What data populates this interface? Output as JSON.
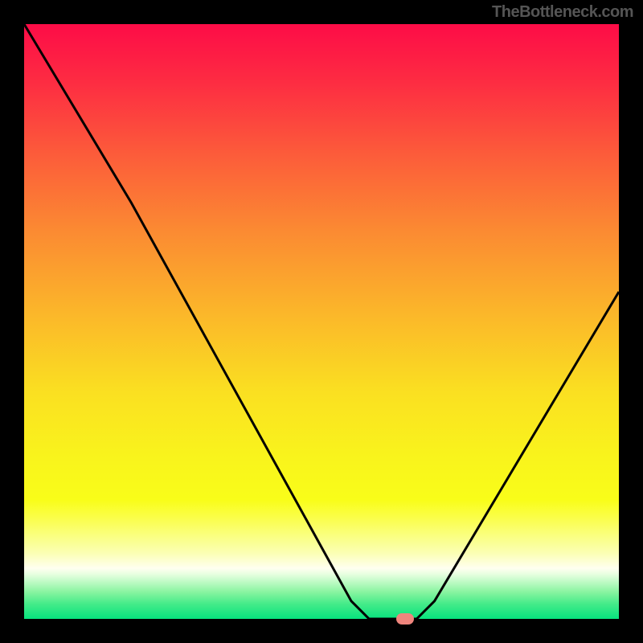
{
  "attribution": "TheBottleneck.com",
  "colors": {
    "background": "#000000",
    "attribution_text": "#555555",
    "curve_stroke": "#000000",
    "marker": "#ef857d",
    "gradient_stops": [
      {
        "offset": 0.0,
        "color": "#fd0c47"
      },
      {
        "offset": 0.1,
        "color": "#fd2d42"
      },
      {
        "offset": 0.22,
        "color": "#fc5c3a"
      },
      {
        "offset": 0.35,
        "color": "#fb8b32"
      },
      {
        "offset": 0.5,
        "color": "#fbbb29"
      },
      {
        "offset": 0.62,
        "color": "#fae021"
      },
      {
        "offset": 0.73,
        "color": "#f9f41c"
      },
      {
        "offset": 0.8,
        "color": "#f9fd19"
      },
      {
        "offset": 0.83,
        "color": "#fafe4a"
      },
      {
        "offset": 0.86,
        "color": "#faff80"
      },
      {
        "offset": 0.89,
        "color": "#fbffb5"
      },
      {
        "offset": 0.915,
        "color": "#fffff0"
      },
      {
        "offset": 0.925,
        "color": "#e6ffe0"
      },
      {
        "offset": 0.94,
        "color": "#b8fac0"
      },
      {
        "offset": 0.955,
        "color": "#88f4a0"
      },
      {
        "offset": 0.975,
        "color": "#44eb89"
      },
      {
        "offset": 1.0,
        "color": "#07e37e"
      }
    ]
  },
  "chart_data": {
    "type": "line",
    "title": "",
    "xlabel": "",
    "ylabel": "",
    "xlim": [
      0,
      100
    ],
    "ylim": [
      0,
      100
    ],
    "curve_points": [
      {
        "x": 0.0,
        "y": 100.0
      },
      {
        "x": 18.0,
        "y": 70.0
      },
      {
        "x": 55.0,
        "y": 3.0
      },
      {
        "x": 58.0,
        "y": 0.0
      },
      {
        "x": 66.0,
        "y": 0.0
      },
      {
        "x": 69.0,
        "y": 3.0
      },
      {
        "x": 100.0,
        "y": 55.0
      }
    ],
    "marker": {
      "x": 64.0,
      "y": 0.0
    },
    "grid": false,
    "legend": false
  }
}
